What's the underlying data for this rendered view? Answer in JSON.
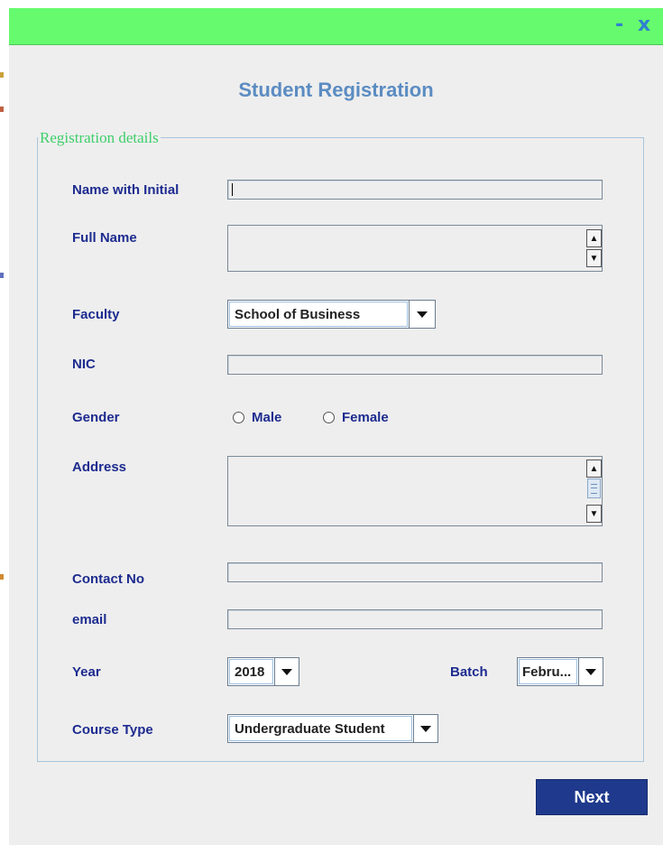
{
  "window": {
    "minimize_label": "-",
    "close_label": "x"
  },
  "title": "Student Registration",
  "panel_legend": "Registration details",
  "fields": {
    "name_with_initial": {
      "label": "Name with Initial",
      "value": ""
    },
    "full_name": {
      "label": "Full Name",
      "value": ""
    },
    "faculty": {
      "label": "Faculty",
      "selected": "School of Business"
    },
    "nic": {
      "label": "NIC",
      "value": ""
    },
    "gender": {
      "label": "Gender",
      "options": [
        "Male",
        "Female"
      ]
    },
    "address": {
      "label": "Address",
      "value": ""
    },
    "contact_no": {
      "label": "Contact No",
      "value": ""
    },
    "email": {
      "label": "email",
      "value": ""
    },
    "year": {
      "label": "Year",
      "selected": "2018"
    },
    "batch": {
      "label": "Batch",
      "selected": "Febru..."
    },
    "course_type": {
      "label": "Course Type",
      "selected": "Undergraduate Student"
    }
  },
  "next_label": "Next",
  "colors": {
    "titlebar": "#66fa6e",
    "title_text": "#5b8cc2",
    "legend_text": "#3ecf6a",
    "label_text": "#1d2b8f",
    "next_button": "#1f3a8c"
  }
}
